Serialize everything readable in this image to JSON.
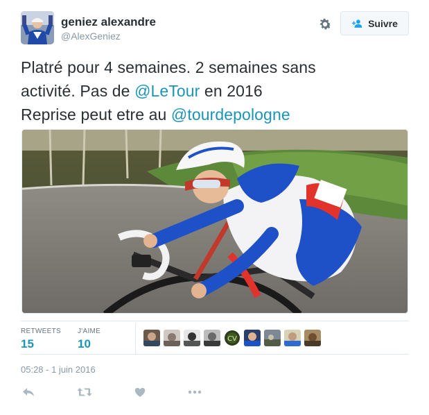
{
  "user": {
    "name": "geniez alexandre",
    "handle": "@AlexGeniez"
  },
  "follow_button": {
    "label": "Suivre",
    "icon": "add-user-icon"
  },
  "tweet": {
    "line1": "Platré pour 4 semaines. 2 semaines sans",
    "line2_a": "activité. Pas de ",
    "mention1": "@LeTour",
    "line2_b": " en 2016",
    "line3_a": "Reprise peut etre au ",
    "mention2": "@tourdepologne"
  },
  "stats": {
    "retweets_label": "RETWEETS",
    "retweets_count": "15",
    "likes_label": "J'AIME",
    "likes_count": "10"
  },
  "likers_count_shown": 9,
  "timestamp": "05:28 - 1 juin 2016",
  "actions": [
    "reply-icon",
    "retweet-icon",
    "heart-icon",
    "more-icon"
  ],
  "colors": {
    "link": "#1b95b7",
    "text": "#292f33",
    "muted": "#8899a6",
    "icon": "#aab8c2",
    "border": "#e1e8ed"
  }
}
